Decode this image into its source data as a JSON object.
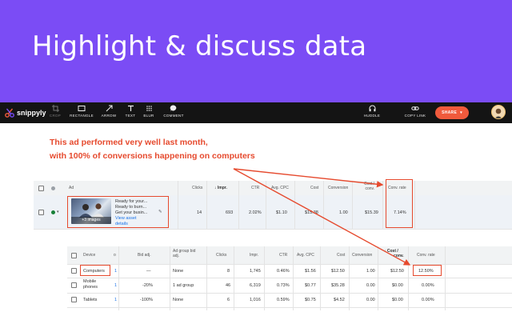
{
  "banner": {
    "title": "Highlight & discuss data",
    "bg": "#7b4cf5"
  },
  "toolbar": {
    "brand": "snippyly",
    "tools": [
      {
        "label": "CROP"
      },
      {
        "label": "RECTANGLE"
      },
      {
        "label": "ARROW"
      },
      {
        "label": "TEXT"
      },
      {
        "label": "BLUR"
      },
      {
        "label": "COMMENT"
      }
    ],
    "right_tools": [
      {
        "label": "HUDDLE"
      },
      {
        "label": "COPY LINK"
      }
    ],
    "share_label": "SHARE",
    "accent": "#f05a3c"
  },
  "annotation": {
    "line1": "This ad performed very well last month,",
    "line2": "with 100% of conversions happening on computers",
    "color": "#e64a2e"
  },
  "ad_table": {
    "headers": {
      "ad": "Ad",
      "clicks": "Clicks",
      "impr": "Impr.",
      "ctr": "CTR",
      "avg_cpc": "Avg. CPC",
      "cost": "Cost",
      "conversions": "Conversion",
      "cost_per_conv_1": "Cost /",
      "cost_per_conv_2": "conv.",
      "conv_rate": "Conv. rate"
    },
    "row": {
      "ad_line1": "Ready for your...",
      "ad_line2": "Ready to burn...",
      "ad_line3": "Get your busin...",
      "view_link_1": "View asset",
      "view_link_2": "details",
      "image_badge": "+3 images",
      "clicks": "14",
      "impr": "693",
      "ctr": "2.02%",
      "avg_cpc": "$1.10",
      "cost": "$15.38",
      "conversions": "1.00",
      "cost_per_conv": "$15.39",
      "conv_rate": "7.14%"
    }
  },
  "device_table": {
    "headers": {
      "device": "Device",
      "partial": "o",
      "bid_adj": "Bid adj.",
      "ad_group_bid_1": "Ad group bid",
      "ad_group_bid_2": "adj.",
      "clicks": "Clicks",
      "impr": "Impr.",
      "ctr": "CTR",
      "avg_cpc": "Avg. CPC",
      "cost": "Cost",
      "conversions": "Conversion",
      "cost_per_conv_1": "Cost /",
      "cost_per_conv_2": "conv.",
      "conv_rate": "Conv. rate"
    },
    "rows": [
      {
        "device": "Computers",
        "partial": "1",
        "bid_adj": "—",
        "ad_group_bid": "None",
        "clicks": "8",
        "impr": "1,745",
        "ctr": "0.46%",
        "avg_cpc": "$1.56",
        "cost": "$12.50",
        "conversions": "1.00",
        "cost_per_conv": "$12.50",
        "conv_rate": "12.50%"
      },
      {
        "device_1": "Mobile",
        "device_2": "phones",
        "partial": "1",
        "bid_adj": "-20%",
        "ad_group_bid": "1 ad group",
        "clicks": "46",
        "impr": "6,319",
        "ctr": "0.73%",
        "avg_cpc": "$0.77",
        "cost": "$35.28",
        "conversions": "0.00",
        "cost_per_conv": "$0.00",
        "conv_rate": "0.00%"
      },
      {
        "device": "Tablets",
        "partial": "1",
        "bid_adj": "-100%",
        "ad_group_bid": "None",
        "clicks": "6",
        "impr": "1,016",
        "ctr": "0.59%",
        "avg_cpc": "$0.75",
        "cost": "$4.52",
        "conversions": "0.00",
        "cost_per_conv": "$0.00",
        "conv_rate": "0.00%"
      }
    ]
  }
}
